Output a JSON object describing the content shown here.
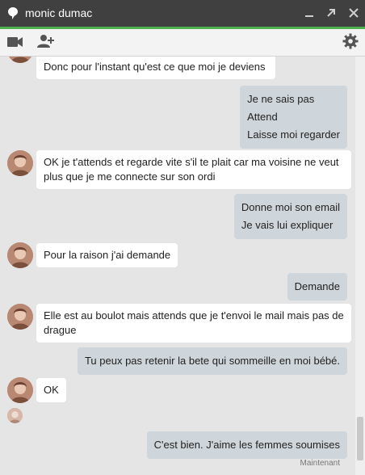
{
  "window": {
    "title": "monic dumac",
    "controls": [
      "minimize-icon",
      "popout-icon",
      "close-icon"
    ]
  },
  "toolbar": {
    "left_icons": [
      "video-call-icon",
      "add-person-icon"
    ],
    "right_icons": [
      "gear-icon"
    ]
  },
  "colors": {
    "titlebar": "#404040",
    "accent": "#4caf50",
    "incoming_bubble": "#ffffff",
    "outgoing_bubble": "#cfd6db",
    "background": "#e5e5e5"
  },
  "messages": [
    {
      "from": "contact",
      "lines": [
        "Donc pour l'instant qu'est ce que moi je deviens"
      ]
    },
    {
      "from": "me",
      "lines": [
        "Je ne sais pas",
        "Attend",
        "Laisse moi regarder"
      ]
    },
    {
      "from": "contact",
      "lines": [
        "OK je t'attends et regarde vite s'il te plait car ma voisine ne veut plus que je me connecte sur son ordi"
      ]
    },
    {
      "from": "me",
      "lines": [
        "Donne moi son email",
        "Je vais lui expliquer"
      ]
    },
    {
      "from": "contact",
      "lines": [
        "Pour la raison j'ai demande"
      ]
    },
    {
      "from": "me",
      "lines": [
        "Demande"
      ]
    },
    {
      "from": "contact",
      "lines": [
        "Elle est au boulot mais attends que je t'envoi le mail mais pas de drague"
      ]
    },
    {
      "from": "me",
      "lines": [
        "Tu peux pas retenir la bete qui sommeille en moi bébé."
      ]
    },
    {
      "from": "contact",
      "lines": [
        "OK"
      ]
    },
    {
      "from": "me",
      "lines": [
        "C'est bien. J'aime les femmes soumises"
      ]
    }
  ],
  "timestamp": "Maintenant"
}
